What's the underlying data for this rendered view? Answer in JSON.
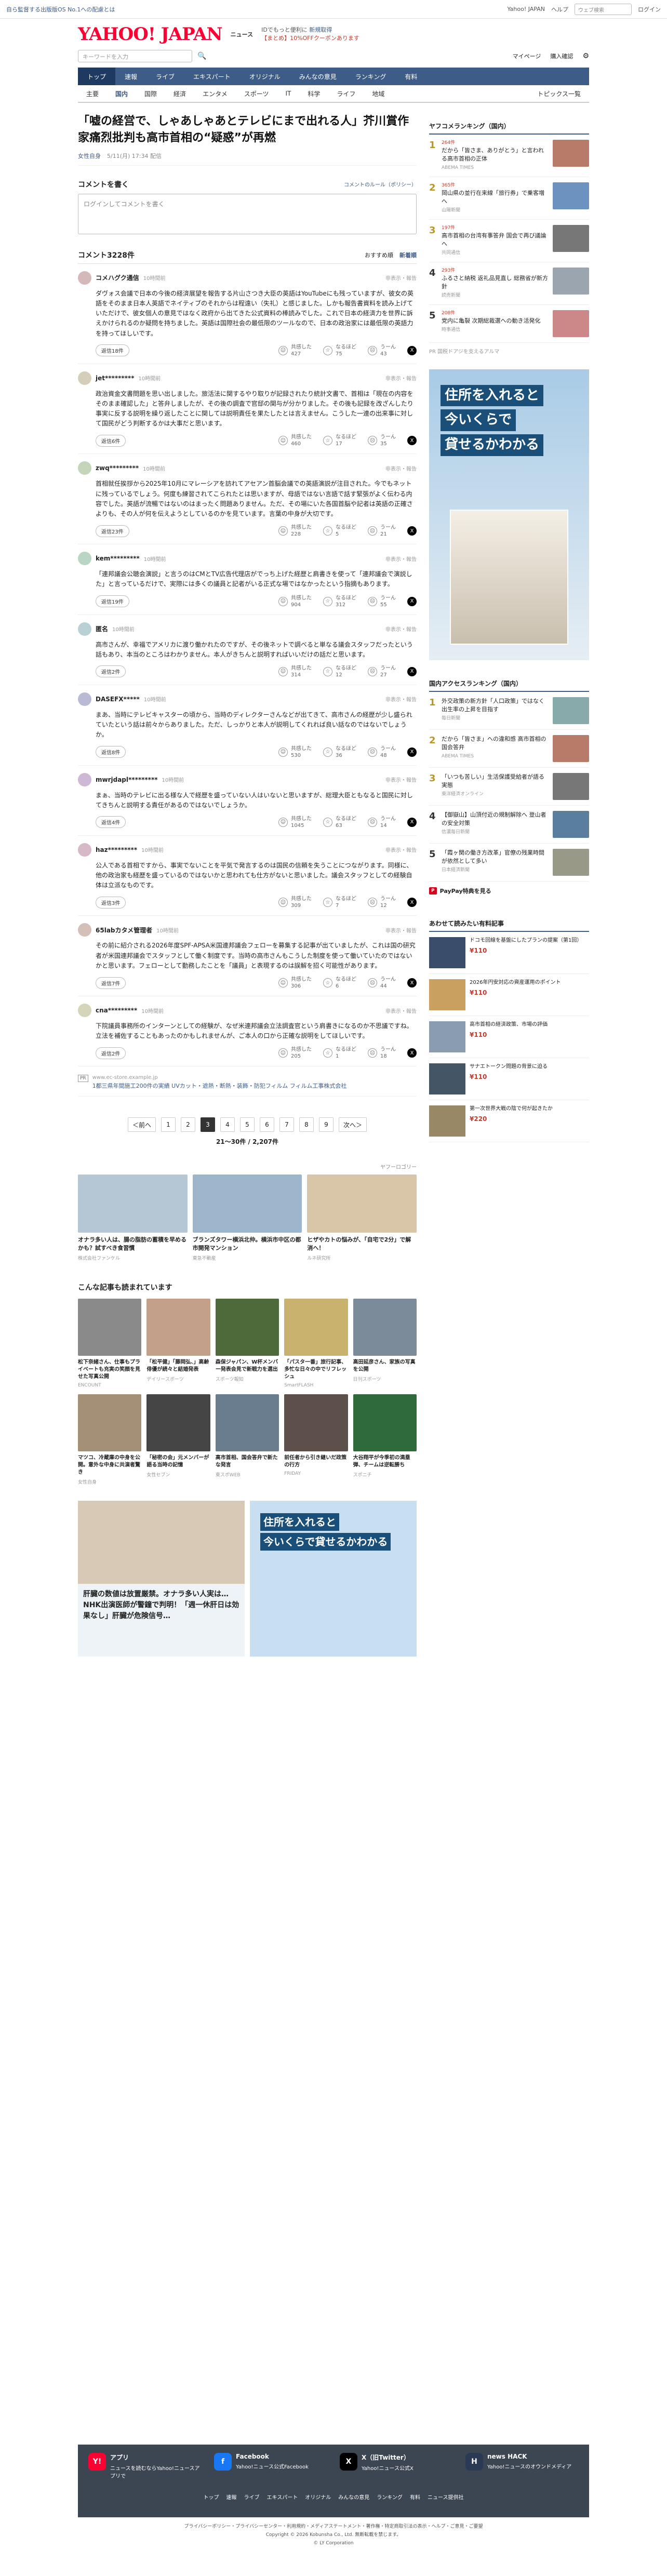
{
  "topbar": {
    "promo": "自ら監督する出版版OS No.1への配慮とは",
    "links": [
      "Yahoo! JAPAN",
      "ヘルプ"
    ],
    "search_ph": "ウェブ検索",
    "login": "ログイン"
  },
  "header": {
    "logo": "YAHOO! JAPAN",
    "service": "ニュース",
    "side1": "IDでもっと便利に",
    "side_link": "新規取得",
    "side2": "【まとめ】10%OFFクーポンあります",
    "yahoo_link": "Yahoo! JAPAN",
    "help": "ヘルプ"
  },
  "search": {
    "placeholder": "キーワードを入力",
    "btn": "検索",
    "mypage": "マイページ",
    "settings": "購入確認",
    "gear": "設定"
  },
  "gnav": [
    "トップ",
    "速報",
    "ライブ",
    "エキスパート",
    "オリジナル",
    "みんなの意見",
    "ランキング",
    "有料"
  ],
  "lnav": [
    "主要",
    "国内",
    "国際",
    "経済",
    "エンタメ",
    "スポーツ",
    "IT",
    "科学",
    "ライフ",
    "地域"
  ],
  "lnav_right": "トピックス一覧",
  "article": {
    "title": "「嘘の経営で、しゃあしゃあとテレビにまで出れる人」芥川賞作家痛烈批判も高市首相の“疑惑”が再燃",
    "source": "女性自身",
    "date": "5/11(月) 17:34 配信"
  },
  "comment_box": {
    "title": "コメントを書く",
    "rule": "コメントのルール（ポリシー）",
    "placeholder": "ログインしてコメントを書く"
  },
  "comments_head": {
    "title": "コメント3228件",
    "sort1": "おすすめ順",
    "sort2": "新着順"
  },
  "reply_label": "返信",
  "report_label": "非表示・報告",
  "vote_labels": [
    "共感した",
    "なるほど",
    "うーん"
  ],
  "comments": [
    {
      "name": "コメハグク通信",
      "time": "10時間前",
      "body": "ダヴォス会議で日本の今後の経済展望を報告する片山さつき大臣の英語はYouTubeにも残っていますが、彼女の英語をそのまま日本人英語でネイティブのそれからは程遠い（失礼）と感じました。しかも報告書資料を読み上げていただけで、彼女個人の意見ではなく政府から出てきた公式資料の棒読みでした。これで日本の経済力を世界に訴えかけられるのか疑問を持ちました。英語は国際社会の最低限のツールなので、日本の政治家には最低限の英語力を持ってほしいです。",
      "replies": "返信18件",
      "v1": "427",
      "v2": "75",
      "v3": "43"
    },
    {
      "name": "jet*********",
      "time": "10時間前",
      "body": "政治資金文書問題を思い出しました。旅活法に関するやり取りが記録されたり統計文書で、首相は「現在の内容をそのまま確認した」と答弁しましたが、その後の調査で官邸の関与が分かりました。その後も記録を改ざんしたり事実に反する説明を繰り返したことに関しては説明責任を果たしたとは言えません。こうした一連の出来事に対して国民がどう判断するかは大事だと思います。",
      "replies": "返信6件",
      "v1": "460",
      "v2": "17",
      "v3": "35"
    },
    {
      "name": "zwq*********",
      "time": "10時間前",
      "body": "首相就任挨拶から2025年10月にマレーシアを訪れてアセアン首脳会議での英語演説が注目された。今でもネットに残っているでしょう。何度も練習されてこられたとは思いますが、母語ではない言語で話す緊張がよく伝わる内容でした。英語が流暢ではないのはまったく問題ありません。ただ、その場にいた各国首脳や記者は英語の正確さよりも、その人が何を伝えようとしているのかを見ています。言葉の中身が大切です。",
      "replies": "返信23件",
      "v1": "228",
      "v2": "5",
      "v3": "21"
    },
    {
      "name": "kem*********",
      "time": "10時間前",
      "body": "「連邦議会公聴会演説」と言うのはCMとTV広告代理店がでっち上げた経歴と肩書きを使って「連邦議会で演説した」と言っているだけで、実際には多くの議員と記者がいる正式な場ではなかったという指摘もあります。",
      "replies": "返信19件",
      "v1": "904",
      "v2": "312",
      "v3": "55"
    },
    {
      "name": "匿名",
      "time": "10時間前",
      "body": "高市さんが、幸福でアメリカに渡り働かれたのですが、その後ネットで調べると単なる議会スタッフだったという話もあり、本当のところはわかりません。本人がきちんと説明すればいいだけの話だと思います。",
      "replies": "返信2件",
      "v1": "314",
      "v2": "12",
      "v3": "27"
    },
    {
      "name": "DASEFX*****",
      "time": "10時間前",
      "body": "まあ、当時にテレビキャスターの頃から、当時のディレクターさんなどが出てきて、高市さんの経歴が少し盛られていたという話は前々からありました。ただ、しっかりと本人が説明してくれれば良い話なのではないでしょうか。",
      "replies": "返信8件",
      "v1": "530",
      "v2": "36",
      "v3": "48"
    },
    {
      "name": "mwrjdapl*********",
      "time": "10時間前",
      "body": "まぁ、当時のテレビに出る様な人で経歴を盛っていない人はいないと思いますが、総理大臣ともなると国民に対してきちんと説明する責任があるのではないでしょうか。",
      "replies": "返信4件",
      "v1": "1045",
      "v2": "63",
      "v3": "14"
    },
    {
      "name": "haz*********",
      "time": "10時間前",
      "body": "公人である首相ですから、事実でないことを平気で発言するのは国民の信頼を失うことにつながります。同様に、他の政治家も経歴を盛っているのではないかと思われても仕方がないと思いました。議会スタッフとしての経験自体は立派なものです。",
      "replies": "返信3件",
      "v1": "309",
      "v2": "7",
      "v3": "12"
    },
    {
      "name": "65labカタメ管理者",
      "time": "10時間前",
      "body": "その前に紹介される2026年度SPF-APSA米国連邦議会フェローを募集する記事が出ていましたが、これは国の研究者が米国連邦議会でスタッフとして働く制度です。当時の高市さんもこうした制度を使って働いていたのではないかと思います。フェローとして勤務したことを「議員」と表現するのは誤解を招く可能性があります。",
      "replies": "返信7件",
      "v1": "306",
      "v2": "6",
      "v3": "44"
    },
    {
      "name": "cna*********",
      "time": "10時間前",
      "body": "下院議員事務所のインターンとしての経験が、なぜ米連邦議会立法調査官という肩書きになるのか不思議ですね。立法を補佐することもあったのかもしれませんが、ご本人の口から正確な説明をしてほしいです。",
      "replies": "返信2件",
      "v1": "205",
      "v2": "1",
      "v3": "18"
    }
  ],
  "ad_line": {
    "badge": "PR",
    "domain": "www.ec-store.example.jp",
    "text": "1都三県年間施工200件の実績 UVカット・遮熱・断熱・装飾・防犯フィルム フィルム工事株式会社"
  },
  "pager": {
    "prev": "＜前へ",
    "pages": [
      "1",
      "2",
      "3",
      "4",
      "5",
      "6",
      "7",
      "8",
      "9"
    ],
    "current": "3",
    "next": "次へ＞",
    "count": "21～30件 / 2,207件"
  },
  "sponsor": "ヤフーロゴリー",
  "ads": [
    {
      "title": "オナラ多い人は、腸の脂肪の蓄積を早めるかも？試すべき食習慣",
      "src": "株式会社ファンケル",
      "color": "#b5c7d4"
    },
    {
      "title": "ブランズタワー横浜北仲。横浜市中区の都市開発マンション",
      "src": "東急不動産",
      "color": "#9db6cc"
    },
    {
      "title": "ヒザやカトの悩みが、「自宅で2分」で解消へ！",
      "src": "ルネ研究所",
      "color": "#d9c5a8"
    }
  ],
  "related": {
    "title": "こんな記事も読まれています",
    "items": [
      {
        "title": "松下奈緒さん、仕事もプライベートも充実の笑顔を見せた写真公開",
        "src": "ENCOUNT",
        "color": "#8a8a8a"
      },
      {
        "title": "「松平健」「藤岡弘、」高齢俳優が続々と結婚発表",
        "src": "デイリースポーツ",
        "color": "#c2a08a"
      },
      {
        "title": "森保ジャパン、W杯メンバー発表会見で新戦力を選出",
        "src": "スポーツ報知",
        "color": "#4e6a3a"
      },
      {
        "title": "「パスタ一番」旅行記事、多忙な日々の中でリフレッシュ",
        "src": "SmartFLASH",
        "color": "#c9b26d"
      },
      {
        "title": "高田延彦さん、家族の写真を公開",
        "src": "日刊スポーツ",
        "color": "#7c8b9a"
      },
      {
        "title": "マツコ、冷蔵庫の中身を公開。意外な中身に共演者驚き",
        "src": "女性自身",
        "color": "#a39076"
      },
      {
        "title": "「秘密の会」元メンバーが語る当時の記憶",
        "src": "女性セブン",
        "color": "#454545"
      },
      {
        "title": "高市首相、国会答弁で新たな発言",
        "src": "東スポWEB",
        "color": "#6a7d8e"
      },
      {
        "title": "前任者から引き継いだ政策の行方",
        "src": "FRIDAY",
        "color": "#5d4f4a"
      },
      {
        "title": "大谷翔平が今季初の満塁弾、チームは逆転勝ち",
        "src": "スポニチ",
        "color": "#2f6a3a"
      }
    ]
  },
  "bigad": {
    "left": "肝臓の数値は放置厳禁。オナラ多い人実は…NHK出演医師が警鐘で判明！「週一休肝日は効果なし」肝臓が危険信号…",
    "right1": "住所を入れると",
    "right2": "今いくらで貸せるかわかる"
  },
  "side": {
    "ranking_title": "ヤフコメランキング（国内）",
    "ranking": [
      {
        "no": "1",
        "cm": "264件",
        "title": "だから「皆さま、ありがとう」と言われる高市首相の正体",
        "src": "ABEMA TIMES",
        "color": "#b87b6a"
      },
      {
        "no": "2",
        "cm": "365件",
        "title": "岡山県の並行在来線「旅行券」で乗客増へ",
        "src": "山陽新聞",
        "color": "#6c92c0"
      },
      {
        "no": "3",
        "cm": "197件",
        "title": "高市首相の台湾有事答弁 国会で再び議論へ",
        "src": "共同通信",
        "color": "#777"
      },
      {
        "no": "4",
        "cm": "293件",
        "title": "ふるさと納税 返礼品見直し 総務省が新方針",
        "src": "読売新聞",
        "color": "#9aa5b0"
      },
      {
        "no": "5",
        "cm": "208件",
        "title": "党内に亀裂 次期総裁選への動き活発化",
        "src": "時事通信",
        "color": "#c88"
      }
    ],
    "pr_label": "PR",
    "pr_text": "国税ドアジを支えるアルマ",
    "ad_lines": [
      "住所を入れると",
      "今いくらで",
      "貸せるかわかる"
    ],
    "access_title": "国内アクセスランキング（国内）",
    "access": [
      {
        "no": "1",
        "title": "外交政策の新方針「人口政策」ではなく出生率の上昇を目指す",
        "src": "毎日新聞",
        "color": "#8aa"
      },
      {
        "no": "2",
        "title": "だから「皆さま」への違和感 高市首相の国会答弁",
        "src": "ABEMA TIMES",
        "color": "#b87b6a"
      },
      {
        "no": "3",
        "title": "「いつも苦しい」生活保護受給者が語る実態",
        "src": "東洋経済オンライン",
        "color": "#777"
      },
      {
        "no": "4",
        "title": "【御嶽山】山頂付近の規制解除へ 登山者の安全対策",
        "src": "信濃毎日新聞",
        "color": "#5a7e9e"
      },
      {
        "no": "5",
        "title": "「霞ヶ関の働き方改革」官僚の残業時間が依然として多い",
        "src": "日本経済新聞",
        "color": "#998"
      }
    ],
    "paypay": "PayPay特典を見る",
    "shop_title": "あわせて読みたい有料記事",
    "shop": [
      {
        "title": "ドコモ回線を基盤にしたプランの提案（第1回）",
        "price": "¥110",
        "color": "#3a4d6a"
      },
      {
        "title": "2026年円安対応の資産運用のポイント",
        "price": "¥110",
        "color": "#c9a060"
      },
      {
        "title": "高市首相の経済政策、市場の評価",
        "price": "¥110",
        "color": "#8a9cb0"
      },
      {
        "title": "サナエトークン問題の背景に迫る",
        "price": "¥110",
        "color": "#445566"
      },
      {
        "title": "第一次世界大戦の陰で何が起きたか",
        "price": "¥220",
        "color": "#998866"
      }
    ]
  },
  "footer": {
    "apps": [
      {
        "name": "アプリ",
        "desc": "ニュースを読むならYahoo!ニュースアプリで",
        "color": "#ff0033",
        "glyph": "Y!"
      },
      {
        "name": "Facebook",
        "desc": "Yahoo!ニュース公式Facebook",
        "color": "#1877f2",
        "glyph": "f"
      },
      {
        "name": "X（旧Twitter）",
        "desc": "Yahoo!ニュース公式X",
        "color": "#000",
        "glyph": "X"
      },
      {
        "name": "news HACK",
        "desc": "Yahoo!ニュースのオウンドメディア",
        "color": "#2a3a55",
        "glyph": "H"
      }
    ],
    "nav": [
      "トップ",
      "速報",
      "ライブ",
      "エキスパート",
      "オリジナル",
      "みんなの意見",
      "ランキング",
      "有料",
      "ニュース提供社"
    ],
    "legal": "プライバシーポリシー・プライバシーセンター・利用規約・メディアステートメント・著作権・特定商取引法の表示・ヘルプ・ご意見・ご要望",
    "copy": "Copyright © 2026 Kobunsha Co., Ltd. 無断転載を禁じます。",
    "corp": "© LY Corporation"
  }
}
